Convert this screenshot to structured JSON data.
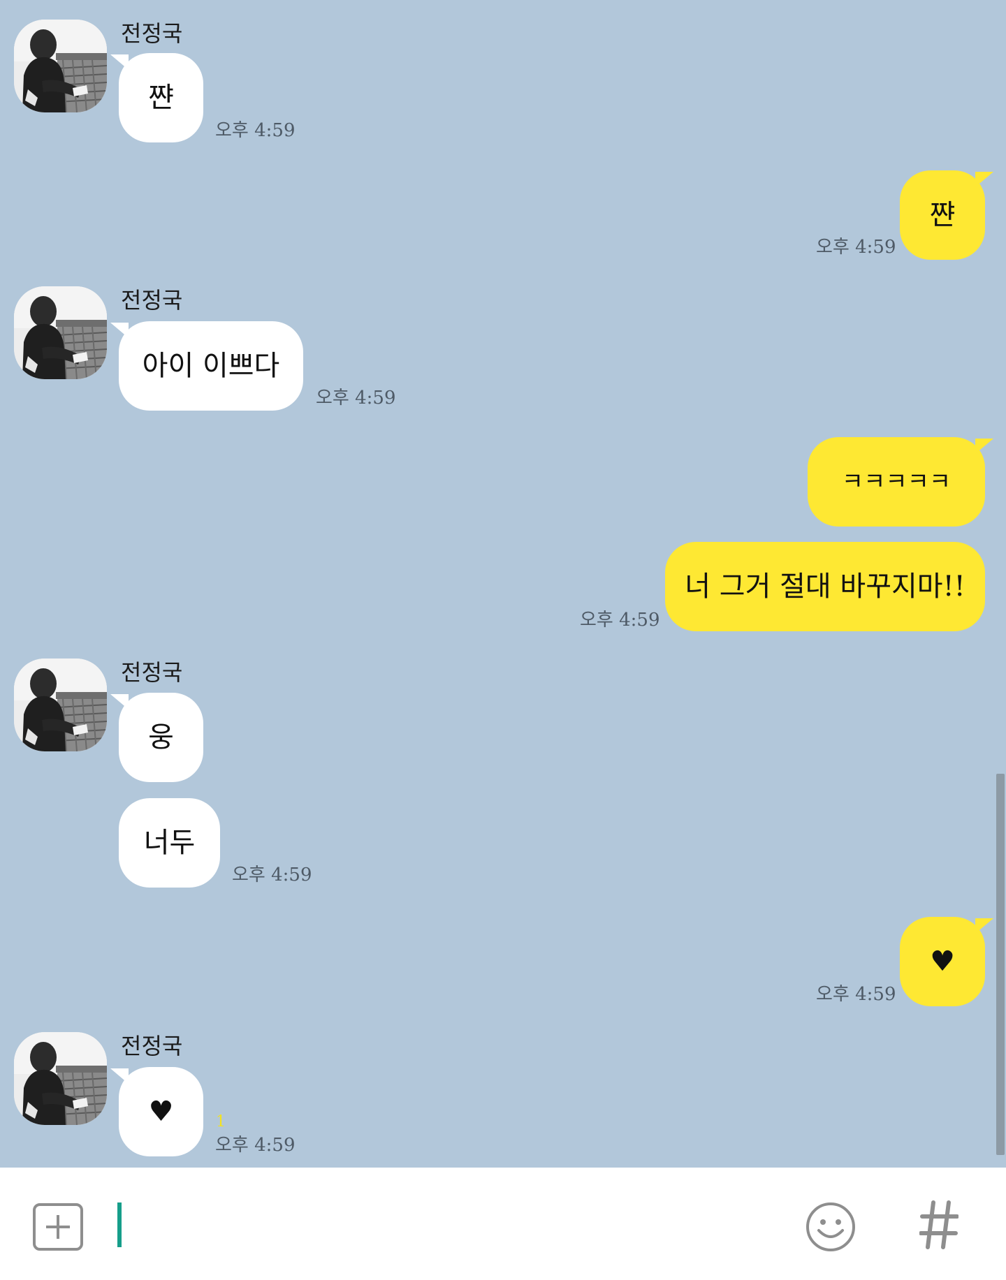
{
  "chat": {
    "partner_name": "전정국",
    "messages": [
      {
        "from": "partner",
        "text": "쨘"
      },
      {
        "from": "me",
        "text": "쨘"
      },
      {
        "from": "partner",
        "text": "아이 이쁘다"
      },
      {
        "from": "me",
        "text": "ㅋㅋㅋㅋㅋ"
      },
      {
        "from": "me",
        "text": "너 그거 절대 바꾸지마!!"
      },
      {
        "from": "partner",
        "text": "웅"
      },
      {
        "from": "partner",
        "text": "너두"
      },
      {
        "from": "me",
        "text": "♥"
      },
      {
        "from": "partner",
        "text": "♥"
      }
    ],
    "timestamps": {
      "t1": "오후 4:59",
      "t2": "오후 4:59",
      "t3": "오후 4:59",
      "t4": "오후 4:59",
      "t5": "오후 4:59",
      "t6": "오후 4:59",
      "t7": "오후 4:59"
    },
    "unread_count": "1"
  },
  "input_bar": {
    "message_value": "",
    "icons": {
      "attach": "plus-icon",
      "emoji": "emoticon-icon",
      "hashtag": "hash-icon"
    }
  },
  "colors": {
    "background": "#b2c7da",
    "received_bubble": "#ffffff",
    "sent_bubble": "#fee833",
    "cursor": "#169e8a",
    "unread": "#f3e21f"
  }
}
